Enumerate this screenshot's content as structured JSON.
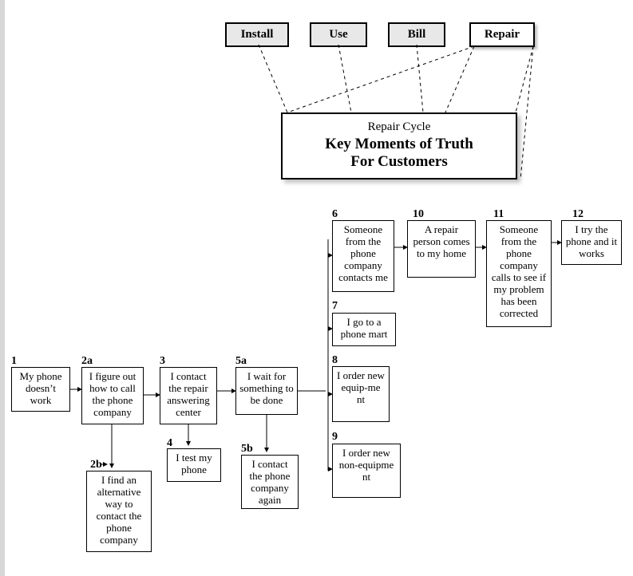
{
  "tabs": {
    "install": "Install",
    "use": "Use",
    "bill": "Bill",
    "repair": "Repair"
  },
  "bigbox": {
    "line1": "Repair Cycle",
    "line2": "Key Moments of Truth",
    "line3": "For Customers"
  },
  "nodes": {
    "n1": {
      "label": "1",
      "text": "My phone doesn’t work"
    },
    "n2a": {
      "label": "2a",
      "text": "I figure out how to call the phone company"
    },
    "n2b": {
      "label": "2b",
      "text": "I find an alternative way to contact the phone company"
    },
    "n3": {
      "label": "3",
      "text": "I contact the repair answering center"
    },
    "n4": {
      "label": "4",
      "text": "I test my phone"
    },
    "n5a": {
      "label": "5a",
      "text": "I wait for something to be done"
    },
    "n5b": {
      "label": "5b",
      "text": "I contact the phone company again"
    },
    "n6": {
      "label": "6",
      "text": "Someone from the phone company contacts me"
    },
    "n7": {
      "label": "7",
      "text": "I go to a phone mart"
    },
    "n8": {
      "label": "8",
      "text": "I order new equip-me nt"
    },
    "n9": {
      "label": "9",
      "text": "I order new non-equipme nt"
    },
    "n10": {
      "label": "10",
      "text": "A repair person comes to my home"
    },
    "n11": {
      "label": "11",
      "text": "Someone from the phone company calls to see if my problem has been corrected"
    },
    "n12": {
      "label": "12",
      "text": "I try the phone and it works"
    }
  }
}
